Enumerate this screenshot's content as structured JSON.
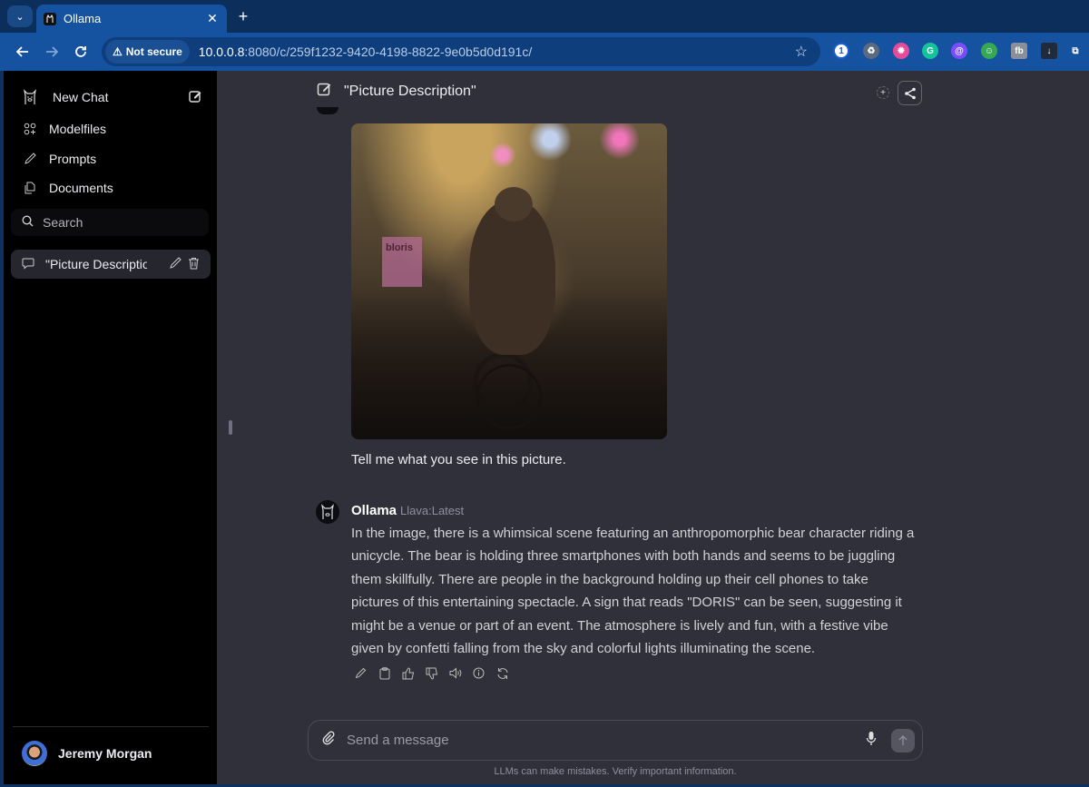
{
  "browser": {
    "tab": {
      "title": "Ollama"
    },
    "url": {
      "security_label": "Not secure",
      "host": "10.0.0.8",
      "path": ":8080/c/259f1232-9420-4198-8822-9e0b5d0d191c/"
    },
    "extensions": [
      {
        "name": "1password",
        "color": "#ffffff",
        "glyph": "1"
      },
      {
        "name": "recycle",
        "color": "#5a6b80",
        "glyph": "♻"
      },
      {
        "name": "color-wheel",
        "color": "#e54b9a",
        "glyph": "✹"
      },
      {
        "name": "grammarly",
        "color": "#15c39a",
        "glyph": "G"
      },
      {
        "name": "writer",
        "color": "#7c4dff",
        "glyph": "@"
      },
      {
        "name": "robot",
        "color": "#34a853",
        "glyph": "☺"
      },
      {
        "name": "fb",
        "color": "#8a8f98",
        "glyph": "fb"
      },
      {
        "name": "download",
        "color": "#1f2b3a",
        "glyph": "↓"
      },
      {
        "name": "puzzle",
        "color": "transparent",
        "glyph": "⧉"
      }
    ]
  },
  "sidebar": {
    "new_chat": "New Chat",
    "items": [
      {
        "label": "Modelfiles"
      },
      {
        "label": "Prompts"
      },
      {
        "label": "Documents"
      }
    ],
    "search_placeholder": "Search",
    "chats": [
      {
        "title": "\"Picture Descriptior"
      }
    ],
    "user": {
      "name": "Jeremy Morgan"
    }
  },
  "chat": {
    "title": "\"Picture Description\"",
    "user_message": "Tell me what you see in this picture.",
    "image_sign_text": "bloris",
    "assistant": {
      "name": "Ollama",
      "model": "Llava:Latest",
      "text": "In the image, there is a whimsical scene featuring an anthropomorphic bear character riding a unicycle. The bear is holding three smartphones with both hands and seems to be juggling them skillfully. There are people in the background holding up their cell phones to take pictures of this entertaining spectacle. A sign that reads \"DORIS\" can be seen, suggesting it might be a venue or part of an event. The atmosphere is lively and fun, with a festive vibe given by confetti falling from the sky and colorful lights illuminating the scene."
    },
    "actions": [
      "edit",
      "copy",
      "good-response",
      "bad-response",
      "read-aloud",
      "generation-info",
      "regenerate"
    ]
  },
  "composer": {
    "placeholder": "Send a message",
    "value": "",
    "disclaimer": "LLMs can make mistakes. Verify important information."
  }
}
